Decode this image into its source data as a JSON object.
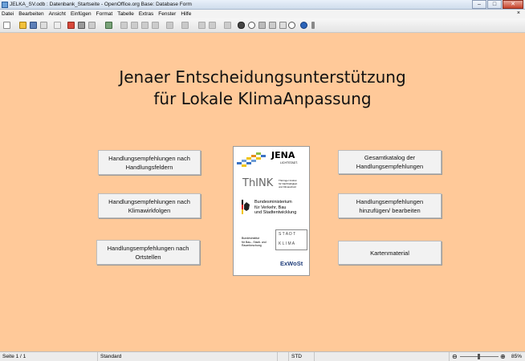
{
  "window": {
    "title": "JELKA_SV.odb : Datenbank_Startseite - OpenOffice.org Base: Database Form",
    "minimize": "–",
    "maximize": "□",
    "close": "✕"
  },
  "menu": {
    "items": [
      "Datei",
      "Bearbeiten",
      "Ansicht",
      "Einfügen",
      "Format",
      "Tabelle",
      "Extras",
      "Fenster",
      "Hilfe"
    ],
    "close_icon": "×"
  },
  "colors": {
    "background": "#ffc999",
    "button": "#f2f2f2",
    "accent_blue": "#3a72c4",
    "accent_yellow": "#f1c40f"
  },
  "content": {
    "heading_line1": "Jenaer Entscheidungsunterstützung",
    "heading_line2": "für Lokale KlimaAnpassung",
    "buttons": {
      "handlungsfeldern": "Handlungsempfehlungen nach\nHandlungsfeldern",
      "klimawirkfolgen": "Handlungsempfehlungen nach\nKlimawirkfolgen",
      "ortstellen": "Handlungsempfehlungen nach\nOrtstellen",
      "gesamtkatalog": "Gesamtkatalog der\nHandlungsempfehlungen",
      "hinzufuegen": "Handlungsempfehlungen\nhinzufügen/ bearbeiten",
      "kartenmaterial": "Kartenmaterial"
    },
    "logos": {
      "jena": "JENA",
      "jena_sub": "LICHTSTADT.",
      "think": "ThINK",
      "think_sub1": "Thüringer Institut",
      "think_sub2": "für Nachhaltigkeit",
      "think_sub3": "und Klimaschutz",
      "bmvbs_line1": "Bundesministerium",
      "bmvbs_line2": "für Verkehr, Bau",
      "bmvbs_line3": "und Stadtentwicklung",
      "bbsr_line1": "Bundesinstitut",
      "bbsr_line2": "für Bau-, Stadt- und",
      "bbsr_line3": "Raumforschung",
      "stadt": "S T A D T",
      "klima": "K L I M A",
      "exwost": "ExWoSt"
    }
  },
  "statusbar": {
    "page": "Seite 1 / 1",
    "style": "Standard",
    "mode": "STD",
    "zoom": "85%",
    "zoom_minus": "⊖",
    "zoom_plus": "⊕"
  }
}
